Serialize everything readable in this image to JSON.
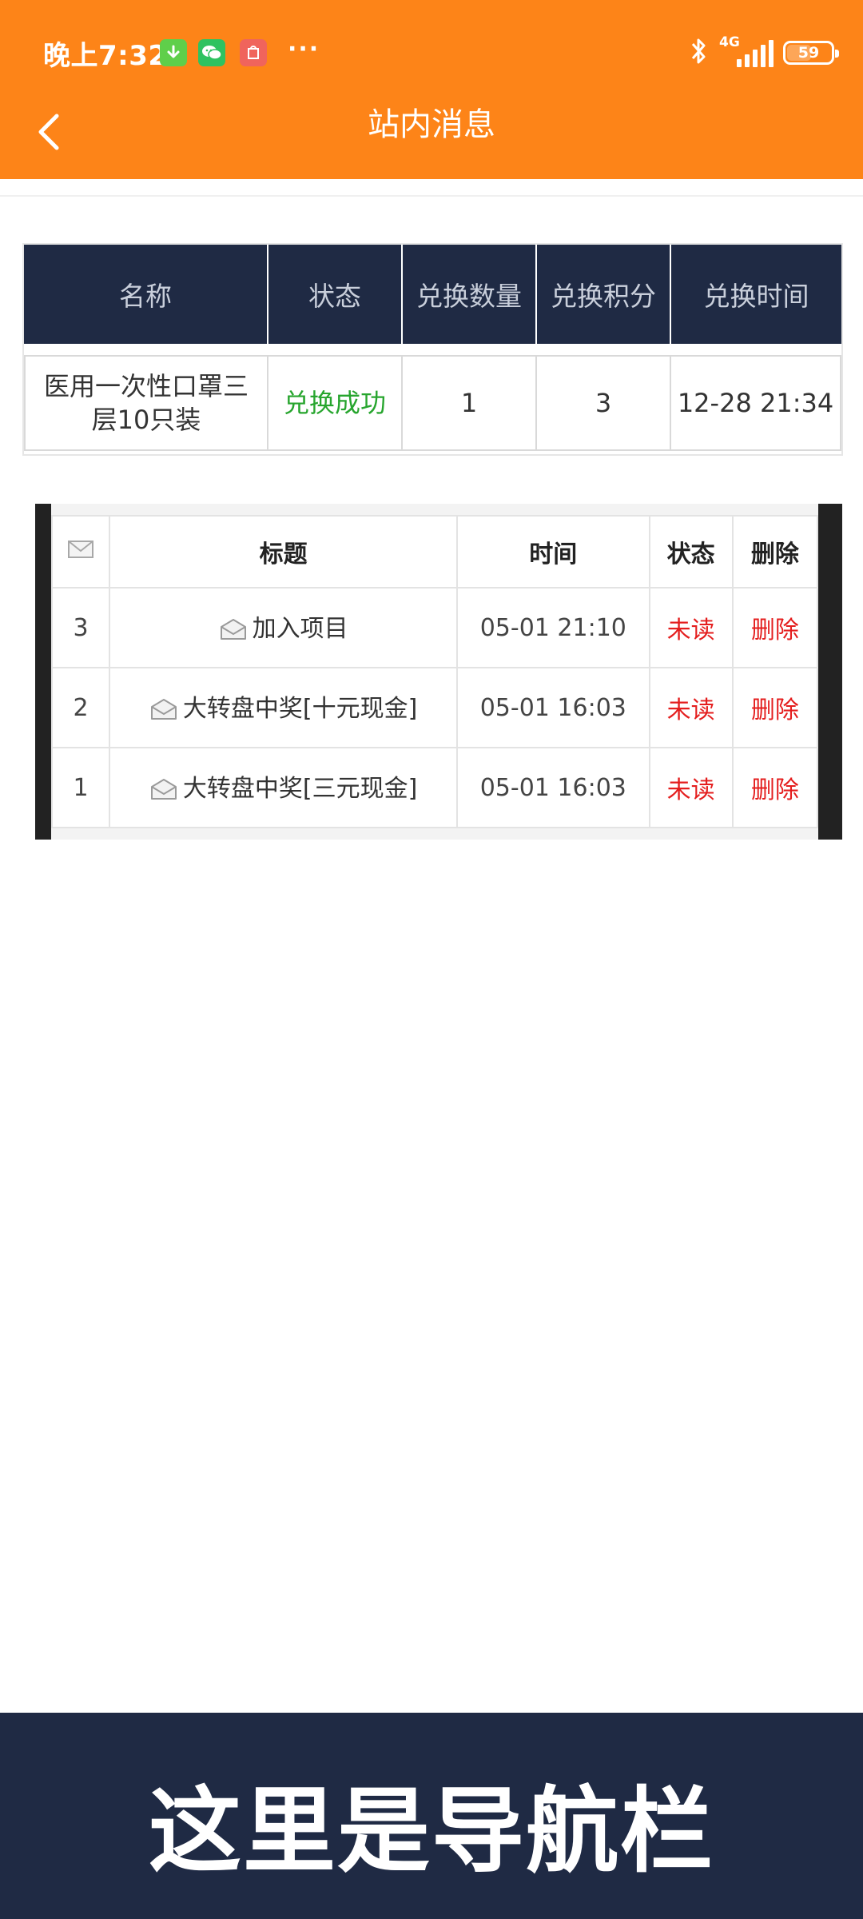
{
  "status_bar": {
    "time": "晚上7:32",
    "more": "···",
    "network": "4G",
    "battery": "59",
    "battery_level": 0.59,
    "icons": [
      "download-icon",
      "wechat-icon",
      "app-notification-icon",
      "bluetooth-icon",
      "signal-icon",
      "battery-icon"
    ]
  },
  "header": {
    "title": "站内消息",
    "back_icon": "chevron-left-icon",
    "background_color": "#fd8418"
  },
  "exchange_table": {
    "columns": [
      "名称",
      "状态",
      "兑换数量",
      "兑换积分",
      "兑换时间"
    ],
    "rows": [
      {
        "name": "医用一次性口罩三层10只装",
        "status": "兑换成功",
        "quantity": "1",
        "points": "3",
        "time": "12-28 21:34"
      }
    ],
    "header_color": "#1f2a44",
    "success_color": "#27a52e"
  },
  "messages_table": {
    "columns": [
      "标题",
      "时间",
      "状态",
      "删除"
    ],
    "header_icon": "envelope-icon",
    "rows": [
      {
        "index": "3",
        "title": "加入项目",
        "time": "05-01 21:10",
        "status": "未读",
        "action": "删除"
      },
      {
        "index": "2",
        "title": "大转盘中奖[十元现金]",
        "time": "05-01 16:03",
        "status": "未读",
        "action": "删除"
      },
      {
        "index": "1",
        "title": "大转盘中奖[三元现金]",
        "time": "05-01 16:03",
        "status": "未读",
        "action": "删除"
      }
    ],
    "unread_color": "#e41e1e"
  },
  "bottom_nav": {
    "text": "这里是导航栏",
    "background_color": "#1f2a44"
  }
}
